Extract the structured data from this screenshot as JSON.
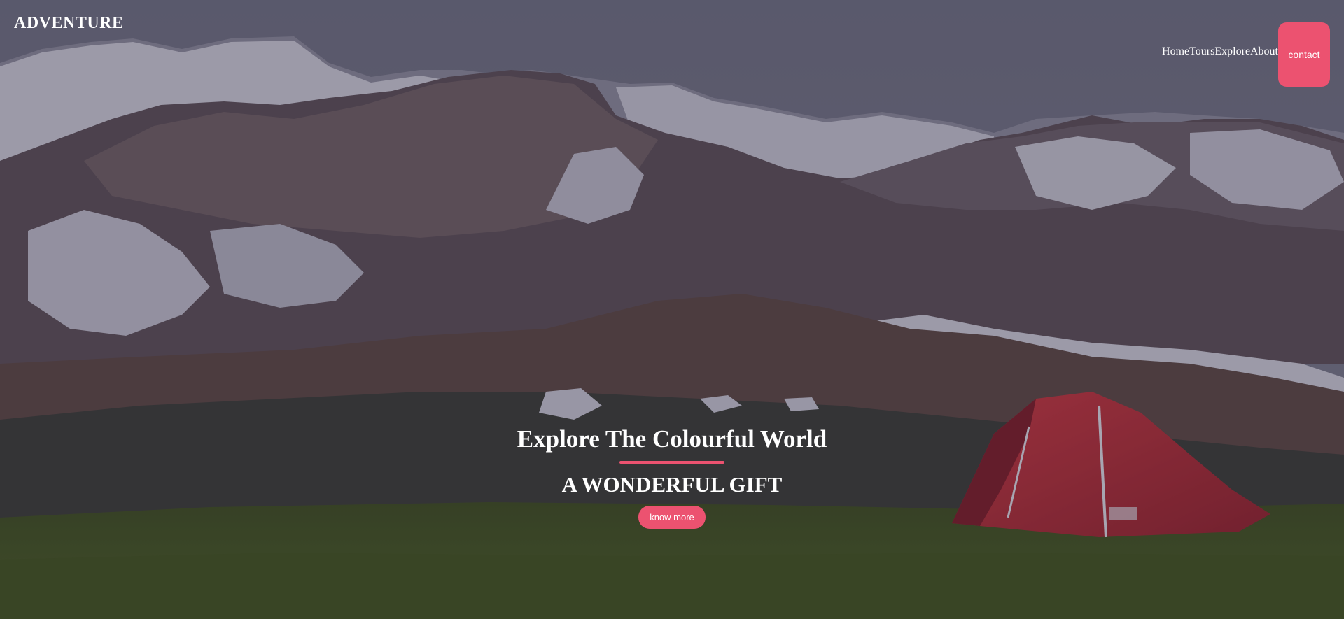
{
  "brand": {
    "logo_text": "ADVENTURE"
  },
  "nav": {
    "items": [
      {
        "label": "Home"
      },
      {
        "label": "Tours"
      },
      {
        "label": "Explore"
      },
      {
        "label": "About"
      }
    ],
    "contact_label": "contact"
  },
  "hero": {
    "title": "Explore The Colourful World",
    "subtitle": "A WONDERFUL GIFT",
    "button_label": "know more"
  },
  "colors": {
    "accent": "#ec5270",
    "text": "#ffffff"
  }
}
